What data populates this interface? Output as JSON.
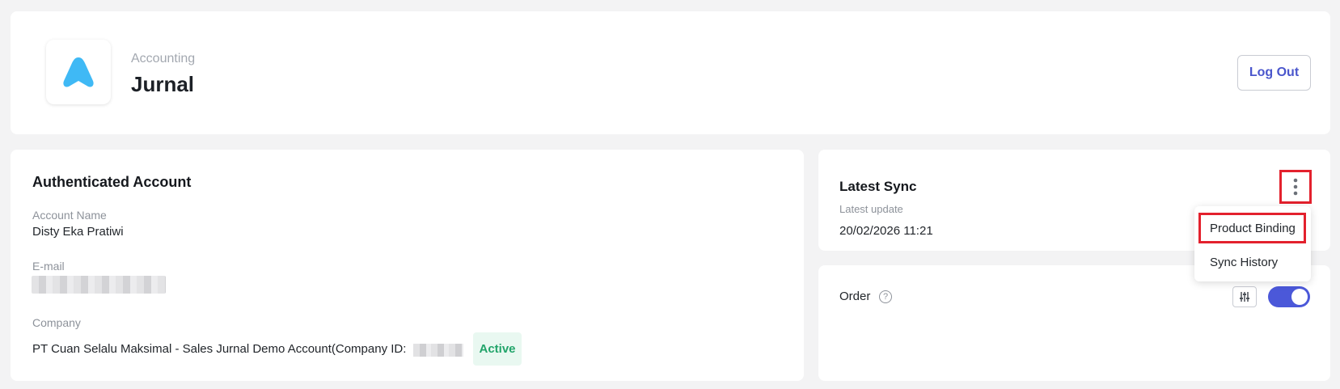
{
  "app": {
    "category": "Accounting",
    "name": "Jurnal",
    "logo_icon": "jurnal-logo",
    "logout_label": "Log Out"
  },
  "account": {
    "title": "Authenticated Account",
    "name_label": "Account Name",
    "name_value": "Disty Eka Pratiwi",
    "email_label": "E-mail",
    "company_label": "Company",
    "company_value": "PT Cuan Selalu Maksimal - Sales Jurnal Demo Account(Company ID:",
    "status_badge": "Active"
  },
  "sync": {
    "title": "Latest Sync",
    "latest_update_label": "Latest update",
    "latest_update_value": "20/02/2026 11:21",
    "more_icon": "more-vertical-icon"
  },
  "menu": {
    "product_binding": "Product Binding",
    "sync_history": "Sync History"
  },
  "order": {
    "label": "Order",
    "help_icon": "question-circle-icon",
    "toggle_on": true
  },
  "colors": {
    "accent": "#4b58d9",
    "logo": "#3fb9f5",
    "highlight": "#e3212d",
    "active": "#22a46a"
  }
}
